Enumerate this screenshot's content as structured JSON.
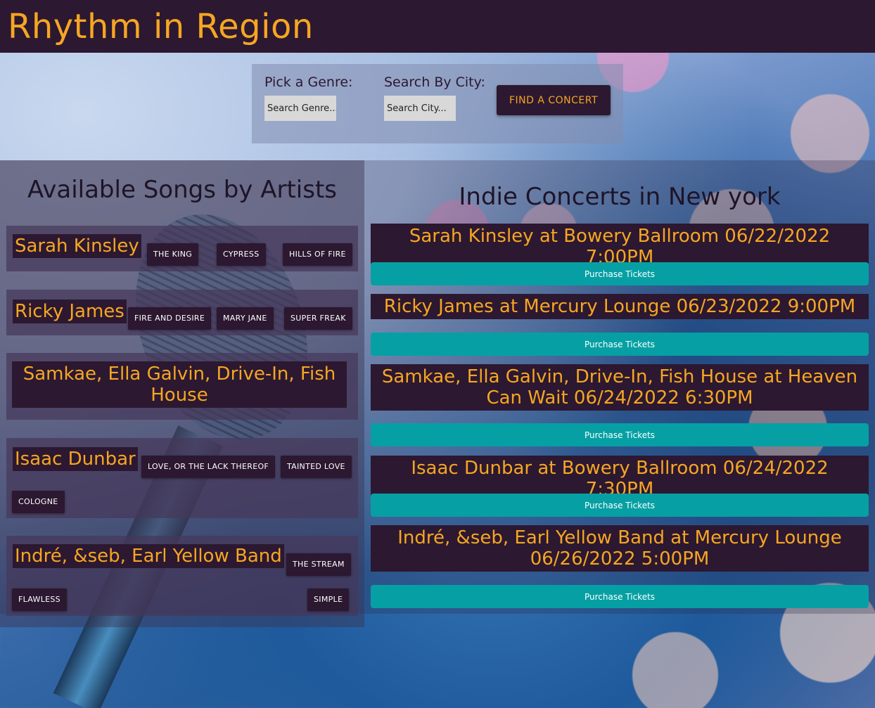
{
  "header": {
    "title": "Rhythm in Region"
  },
  "search": {
    "genre_label": "Pick a Genre:",
    "genre_placeholder": "Search Genre...",
    "city_label": "Search By City:",
    "city_placeholder": "Search City...",
    "find_button": "FIND A CONCERT"
  },
  "songs_section": {
    "title": "Available Songs by Artists",
    "artists": [
      {
        "name": "Sarah Kinsley",
        "songs": [
          "THE KING",
          "CYPRESS",
          "HILLS OF FIRE"
        ]
      },
      {
        "name": "Ricky James",
        "songs": [
          "FIRE AND DESIRE",
          "MARY JANE",
          "SUPER FREAK"
        ]
      },
      {
        "name": "Samkae, Ella Galvin, Drive-In, Fish House",
        "songs": []
      },
      {
        "name": "Isaac Dunbar",
        "songs": [
          "LOVE, OR THE LACK THEREOF",
          "TAINTED LOVE",
          "COLOGNE"
        ]
      },
      {
        "name": "Indré, &seb, Earl Yellow Band",
        "songs": [
          "THE STREAM",
          "FLAWLESS",
          "SIMPLE"
        ]
      }
    ]
  },
  "concerts_section": {
    "title": "Indie Concerts in New york",
    "purchase_label": "Purchase Tickets",
    "concerts": [
      {
        "title": "Sarah Kinsley at Bowery Ballroom 06/22/2022 7:00PM"
      },
      {
        "title": "Ricky James at Mercury Lounge 06/23/2022 9:00PM"
      },
      {
        "title": "Samkae, Ella Galvin, Drive-In, Fish House at Heaven Can Wait 06/24/2022 6:30PM"
      },
      {
        "title": "Isaac Dunbar at Bowery Ballroom 06/24/2022 7:30PM"
      },
      {
        "title": "Indré, &seb, Earl Yellow Band at Mercury Lounge 06/26/2022 5:00PM"
      }
    ]
  },
  "colors": {
    "header_bg": "#2c1830",
    "accent": "#f5a623",
    "button_teal": "#06a0a4"
  }
}
